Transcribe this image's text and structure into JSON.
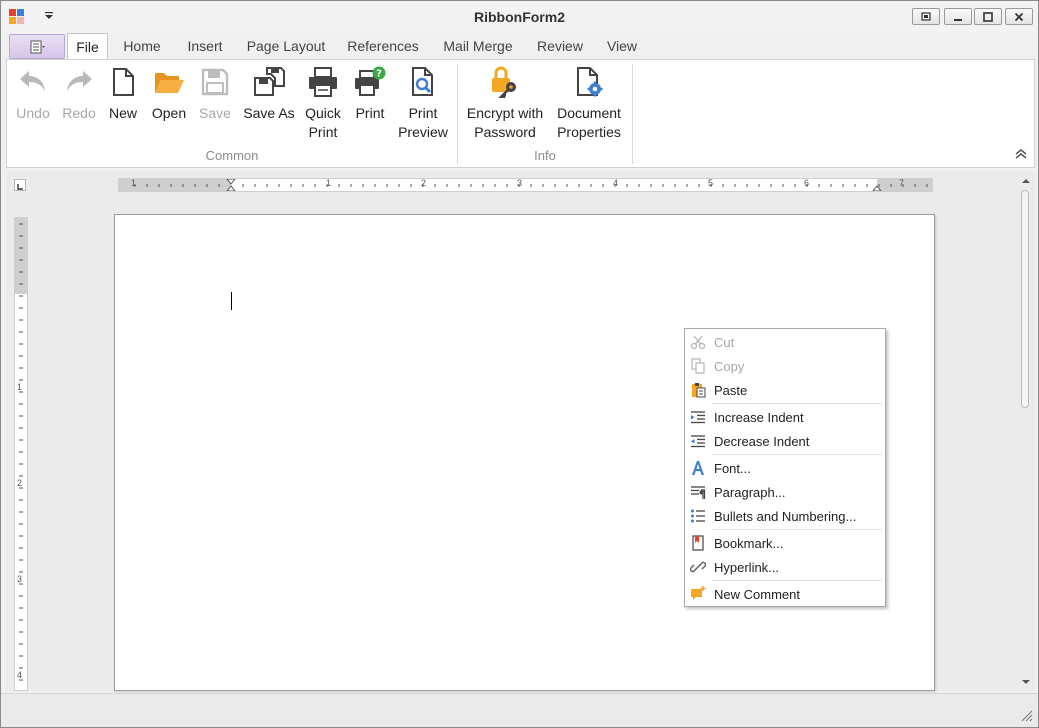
{
  "window": {
    "title": "RibbonForm2",
    "controls": [
      "restore",
      "minimize",
      "maximize",
      "close"
    ]
  },
  "tabs": [
    {
      "id": "file",
      "label": "File",
      "active": true
    },
    {
      "id": "home",
      "label": "Home"
    },
    {
      "id": "insert",
      "label": "Insert"
    },
    {
      "id": "page_layout",
      "label": "Page Layout"
    },
    {
      "id": "references",
      "label": "References"
    },
    {
      "id": "mail_merge",
      "label": "Mail Merge"
    },
    {
      "id": "review",
      "label": "Review"
    },
    {
      "id": "view",
      "label": "View"
    }
  ],
  "ribbon": {
    "groups": [
      {
        "caption": "Common",
        "buttons": [
          {
            "label": "Undo",
            "icon": "undo-icon",
            "disabled": true
          },
          {
            "label": "Redo",
            "icon": "redo-icon",
            "disabled": true
          },
          {
            "label": "New",
            "icon": "new-document-icon"
          },
          {
            "label": "Open",
            "icon": "folder-open-icon"
          },
          {
            "label": "Save",
            "icon": "save-icon",
            "disabled": true
          },
          {
            "label": "Save As",
            "icon": "save-as-icon"
          },
          {
            "label": "Quick\nPrint",
            "icon": "printer-icon"
          },
          {
            "label": "Print",
            "icon": "print-dialog-icon"
          },
          {
            "label": "Print\nPreview",
            "icon": "print-preview-icon"
          }
        ]
      },
      {
        "caption": "Info",
        "buttons": [
          {
            "label": "Encrypt with\nPassword",
            "icon": "lock-key-icon"
          },
          {
            "label": "Document\nProperties",
            "icon": "document-settings-icon"
          }
        ]
      }
    ]
  },
  "rulers": {
    "horizontal_numbers": [
      "1",
      "1",
      "2",
      "3",
      "4",
      "5",
      "6",
      "7"
    ],
    "vertical_numbers": [
      "1",
      "2",
      "3",
      "4"
    ]
  },
  "context_menu": {
    "items": [
      {
        "label": "Cut",
        "icon": "scissors-icon",
        "disabled": true
      },
      {
        "label": "Copy",
        "icon": "copy-icon",
        "disabled": true
      },
      {
        "label": "Paste",
        "icon": "paste-icon"
      },
      {
        "separator": true
      },
      {
        "label": "Increase Indent",
        "icon": "increase-indent-icon"
      },
      {
        "label": "Decrease Indent",
        "icon": "decrease-indent-icon"
      },
      {
        "separator": true
      },
      {
        "label": "Font...",
        "icon": "font-icon"
      },
      {
        "label": "Paragraph...",
        "icon": "paragraph-icon"
      },
      {
        "label": "Bullets and Numbering...",
        "icon": "bullets-icon"
      },
      {
        "separator": true
      },
      {
        "label": "Bookmark...",
        "icon": "bookmark-icon"
      },
      {
        "label": "Hyperlink...",
        "icon": "hyperlink-icon"
      },
      {
        "separator": true
      },
      {
        "label": "New Comment",
        "icon": "comment-icon"
      }
    ]
  },
  "colors": {
    "accent_purple": "#d6c6ea",
    "icon_gray": "#4a4a4a",
    "icon_orange": "#f5a623",
    "icon_blue": "#3d7fd4",
    "icon_green": "#3aa843",
    "disabled_text": "#a8a8a8"
  }
}
